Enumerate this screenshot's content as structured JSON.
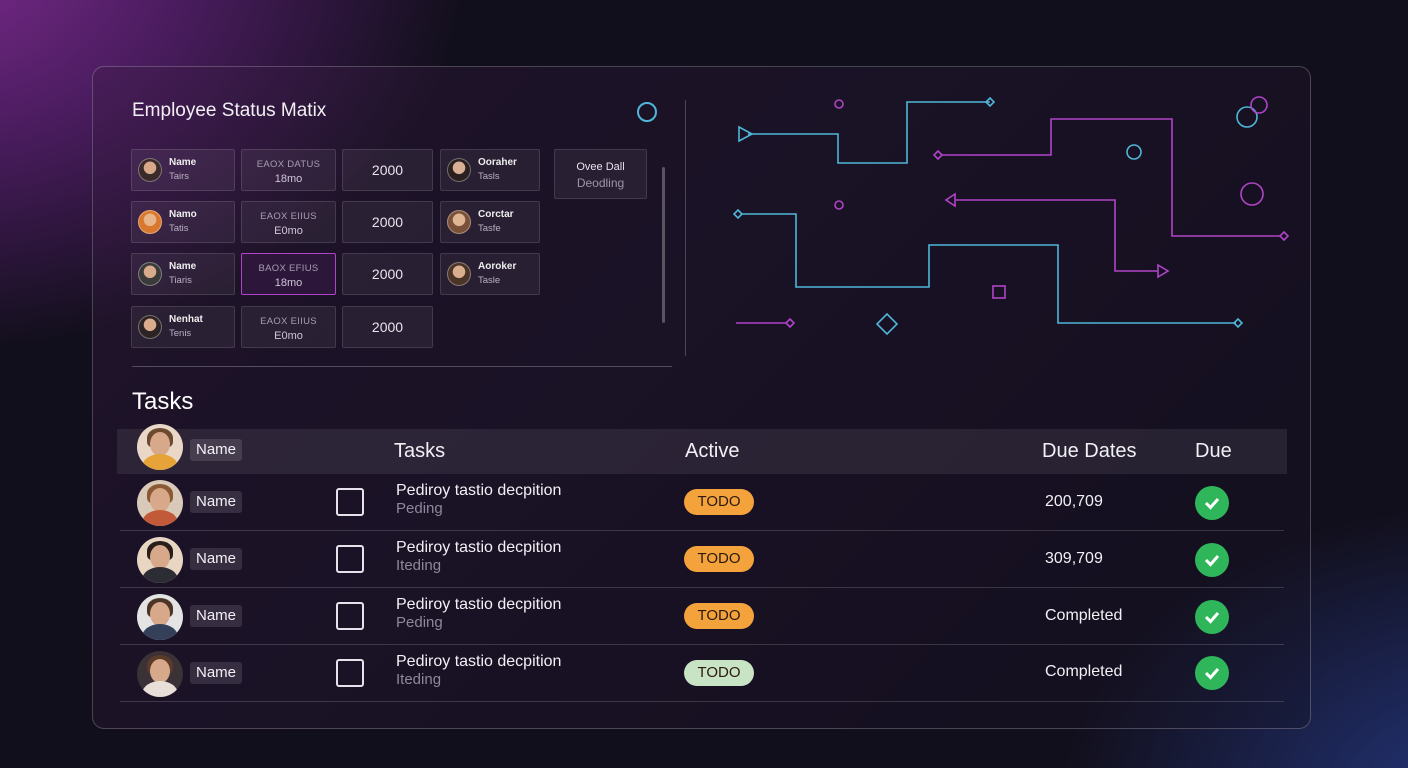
{
  "matrix": {
    "title": "Employee Status Matix",
    "rows": [
      {
        "name": "Name",
        "sub": "Tairs",
        "stat1": "EAOX DATUS",
        "stat2": "18mo",
        "num": "2000",
        "p2name": "Ooraher",
        "p2sub": "Tasls"
      },
      {
        "name": "Namo",
        "sub": "Tatis",
        "stat1": "EAOX EIIUS",
        "stat2": "E0mo",
        "num": "2000",
        "p2name": "Corctar",
        "p2sub": "Tasfe"
      },
      {
        "name": "Name",
        "sub": "Tiaris",
        "stat1": "BAOX EFIUS",
        "stat2": "18mo",
        "num": "2000",
        "p2name": "Aoroker",
        "p2sub": "Tasle"
      },
      {
        "name": "Nenhat",
        "sub": "Tenis",
        "stat1": "EAOX EIIUS",
        "stat2": "E0mo",
        "num": "2000"
      }
    ],
    "side_card": {
      "line1": "Ovee Dall",
      "line2": "Deodling"
    }
  },
  "tasks": {
    "title": "Tasks",
    "header": {
      "name": "Name",
      "tasks": "Tasks",
      "active": "Active",
      "due_dates": "Due Dates",
      "due": "Due"
    },
    "rows": [
      {
        "name": "Name",
        "desc": "Pediroy tastio decpition",
        "sub": "Peding",
        "status": "TODO",
        "status_color": "#f4a23c",
        "due_date": "200,709"
      },
      {
        "name": "Name",
        "desc": "Pediroy tastio decpition",
        "sub": "Iteding",
        "status": "TODO",
        "status_color": "#f4a23c",
        "due_date": "309,709"
      },
      {
        "name": "Name",
        "desc": "Pediroy tastio decpition",
        "sub": "Peding",
        "status": "TODO",
        "status_color": "#f4a23c",
        "due_date": "Completed"
      },
      {
        "name": "Name",
        "desc": "Pediroy tastio decpition",
        "sub": "Iteding",
        "status": "TODO",
        "status_color": "#c9e3c5",
        "due_date": "Completed"
      }
    ]
  },
  "colors": {
    "accent_cyan": "#4fb6d8",
    "accent_magenta": "#b044c8",
    "check_green": "#2fb65a"
  }
}
